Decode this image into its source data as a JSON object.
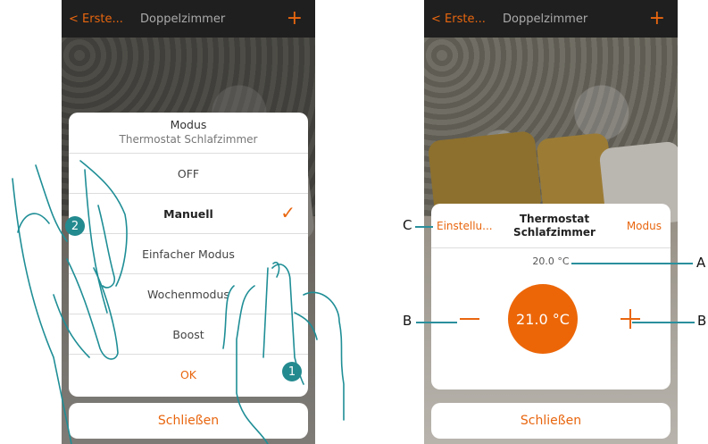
{
  "left_screen": {
    "topbar": {
      "back_label": "< Erste...",
      "title": "Doppelzimmer",
      "plus_symbol": "+"
    },
    "mode_modal": {
      "title": "Modus",
      "subtitle": "Thermostat Schlafzimmer",
      "options": [
        {
          "label": "OFF",
          "selected": false
        },
        {
          "label": "Manuell",
          "selected": true
        },
        {
          "label": "Einfacher Modus",
          "selected": false
        },
        {
          "label": "Wochenmodus",
          "selected": false
        },
        {
          "label": "Boost",
          "selected": false
        }
      ],
      "check_symbol": "✓",
      "ok_label": "OK"
    },
    "close_label": "Schließen",
    "step_markers": [
      "1",
      "2"
    ]
  },
  "right_screen": {
    "topbar": {
      "back_label": "< Erste...",
      "title": "Doppelzimmer",
      "plus_symbol": "+"
    },
    "card": {
      "settings_label": "Einstellu...",
      "title_line1": "Thermostat",
      "title_line2": "Schlafzimmer",
      "mode_label": "Modus",
      "measured_temp": "20.0 °C",
      "setpoint_temp": "21.0 °C"
    },
    "close_label": "Schließen",
    "annotations": {
      "A": "A",
      "B_left": "B",
      "B_right": "B",
      "C": "C"
    }
  },
  "colors": {
    "accent": "#e8660f",
    "annotation": "#2a8f9c",
    "topbar": "#1f1f1f"
  },
  "icons": [
    "check-icon",
    "plus-icon",
    "minus-icon",
    "hand-icon"
  ]
}
